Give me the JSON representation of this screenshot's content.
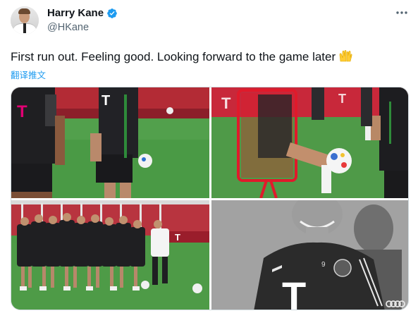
{
  "author": {
    "name": "Harry Kane",
    "handle": "@HKane",
    "avatar_icon": "avatar-photo",
    "verified_icon": "verified-badge-icon",
    "verified_color": "#1d9bf0"
  },
  "more_icon": "more-options-icon",
  "tweet": {
    "text": "First run out. Feeling good. Looking forward to the game later",
    "emoji_icon": "raised-hands-emoji",
    "translate_label": "翻译推文"
  },
  "media": {
    "photos": [
      {
        "id": "photo-1",
        "kit_logo": "T"
      },
      {
        "id": "photo-2",
        "kit_logo": "T"
      },
      {
        "id": "photo-3",
        "kit_logo": "T"
      },
      {
        "id": "photo-4",
        "kit_logo": "T",
        "kit_number": "9"
      }
    ]
  },
  "colors": {
    "link": "#1d9bf0",
    "muted": "#536471",
    "pitch": "#3f8f3c",
    "brand_red": "#dc052d"
  }
}
